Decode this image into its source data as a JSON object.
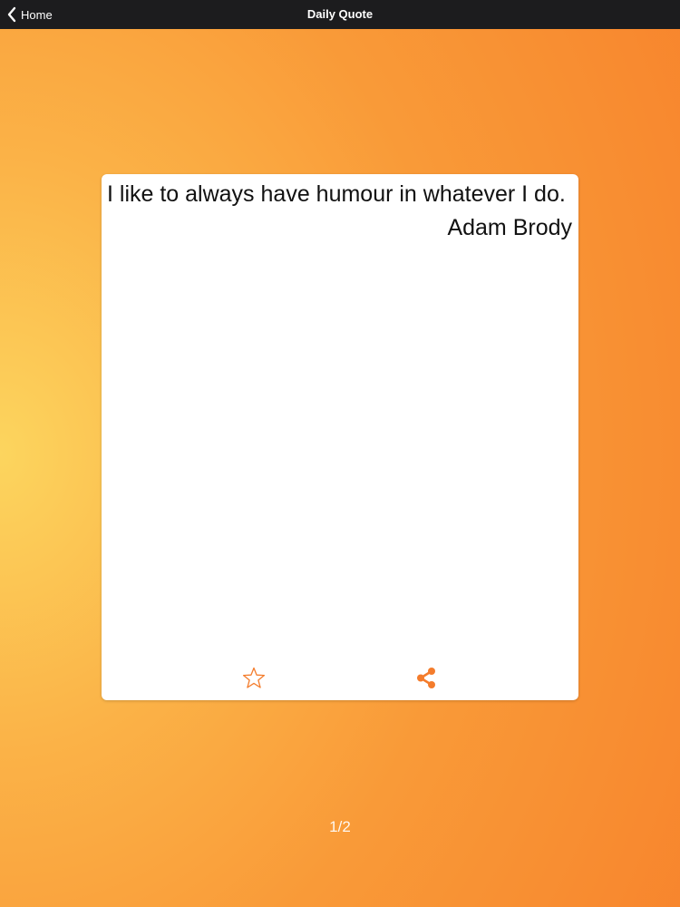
{
  "navbar": {
    "back_label": "Home",
    "title": "Daily Quote",
    "back_icon": "chevron-left-icon"
  },
  "quote": {
    "text": "I like to always have humour in whatever I do.",
    "author": "Adam Brody"
  },
  "actions": {
    "favorite_icon": "star-outline-icon",
    "share_icon": "share-icon"
  },
  "pager": {
    "indicator": "1/2"
  },
  "colors": {
    "accent": "#f47c2c",
    "navbar_bg": "#1c1c1e",
    "gradient_light": "#fcd55e",
    "gradient_dark": "#f7832c"
  }
}
